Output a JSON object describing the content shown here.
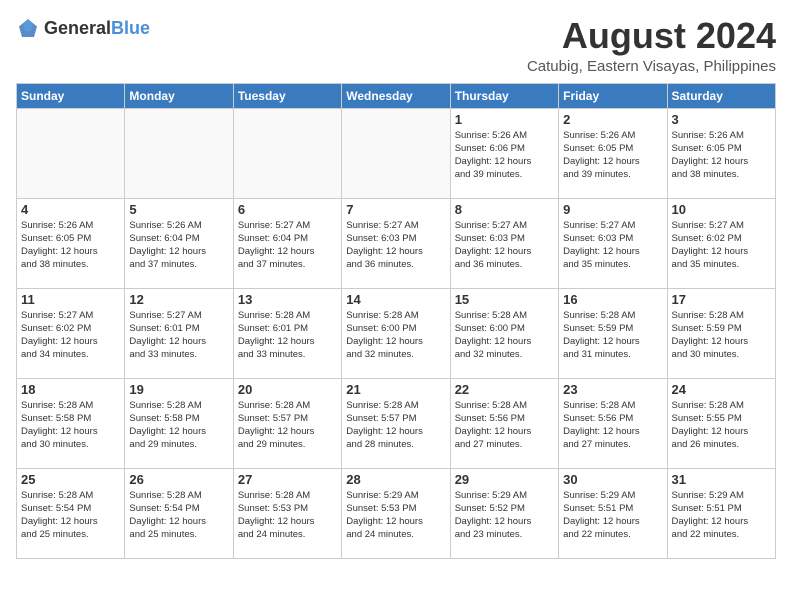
{
  "header": {
    "logo_general": "General",
    "logo_blue": "Blue",
    "month_year": "August 2024",
    "location": "Catubig, Eastern Visayas, Philippines"
  },
  "weekdays": [
    "Sunday",
    "Monday",
    "Tuesday",
    "Wednesday",
    "Thursday",
    "Friday",
    "Saturday"
  ],
  "weeks": [
    [
      {
        "day": "",
        "info": ""
      },
      {
        "day": "",
        "info": ""
      },
      {
        "day": "",
        "info": ""
      },
      {
        "day": "",
        "info": ""
      },
      {
        "day": "1",
        "info": "Sunrise: 5:26 AM\nSunset: 6:06 PM\nDaylight: 12 hours\nand 39 minutes."
      },
      {
        "day": "2",
        "info": "Sunrise: 5:26 AM\nSunset: 6:05 PM\nDaylight: 12 hours\nand 39 minutes."
      },
      {
        "day": "3",
        "info": "Sunrise: 5:26 AM\nSunset: 6:05 PM\nDaylight: 12 hours\nand 38 minutes."
      }
    ],
    [
      {
        "day": "4",
        "info": "Sunrise: 5:26 AM\nSunset: 6:05 PM\nDaylight: 12 hours\nand 38 minutes."
      },
      {
        "day": "5",
        "info": "Sunrise: 5:26 AM\nSunset: 6:04 PM\nDaylight: 12 hours\nand 37 minutes."
      },
      {
        "day": "6",
        "info": "Sunrise: 5:27 AM\nSunset: 6:04 PM\nDaylight: 12 hours\nand 37 minutes."
      },
      {
        "day": "7",
        "info": "Sunrise: 5:27 AM\nSunset: 6:03 PM\nDaylight: 12 hours\nand 36 minutes."
      },
      {
        "day": "8",
        "info": "Sunrise: 5:27 AM\nSunset: 6:03 PM\nDaylight: 12 hours\nand 36 minutes."
      },
      {
        "day": "9",
        "info": "Sunrise: 5:27 AM\nSunset: 6:03 PM\nDaylight: 12 hours\nand 35 minutes."
      },
      {
        "day": "10",
        "info": "Sunrise: 5:27 AM\nSunset: 6:02 PM\nDaylight: 12 hours\nand 35 minutes."
      }
    ],
    [
      {
        "day": "11",
        "info": "Sunrise: 5:27 AM\nSunset: 6:02 PM\nDaylight: 12 hours\nand 34 minutes."
      },
      {
        "day": "12",
        "info": "Sunrise: 5:27 AM\nSunset: 6:01 PM\nDaylight: 12 hours\nand 33 minutes."
      },
      {
        "day": "13",
        "info": "Sunrise: 5:28 AM\nSunset: 6:01 PM\nDaylight: 12 hours\nand 33 minutes."
      },
      {
        "day": "14",
        "info": "Sunrise: 5:28 AM\nSunset: 6:00 PM\nDaylight: 12 hours\nand 32 minutes."
      },
      {
        "day": "15",
        "info": "Sunrise: 5:28 AM\nSunset: 6:00 PM\nDaylight: 12 hours\nand 32 minutes."
      },
      {
        "day": "16",
        "info": "Sunrise: 5:28 AM\nSunset: 5:59 PM\nDaylight: 12 hours\nand 31 minutes."
      },
      {
        "day": "17",
        "info": "Sunrise: 5:28 AM\nSunset: 5:59 PM\nDaylight: 12 hours\nand 30 minutes."
      }
    ],
    [
      {
        "day": "18",
        "info": "Sunrise: 5:28 AM\nSunset: 5:58 PM\nDaylight: 12 hours\nand 30 minutes."
      },
      {
        "day": "19",
        "info": "Sunrise: 5:28 AM\nSunset: 5:58 PM\nDaylight: 12 hours\nand 29 minutes."
      },
      {
        "day": "20",
        "info": "Sunrise: 5:28 AM\nSunset: 5:57 PM\nDaylight: 12 hours\nand 29 minutes."
      },
      {
        "day": "21",
        "info": "Sunrise: 5:28 AM\nSunset: 5:57 PM\nDaylight: 12 hours\nand 28 minutes."
      },
      {
        "day": "22",
        "info": "Sunrise: 5:28 AM\nSunset: 5:56 PM\nDaylight: 12 hours\nand 27 minutes."
      },
      {
        "day": "23",
        "info": "Sunrise: 5:28 AM\nSunset: 5:56 PM\nDaylight: 12 hours\nand 27 minutes."
      },
      {
        "day": "24",
        "info": "Sunrise: 5:28 AM\nSunset: 5:55 PM\nDaylight: 12 hours\nand 26 minutes."
      }
    ],
    [
      {
        "day": "25",
        "info": "Sunrise: 5:28 AM\nSunset: 5:54 PM\nDaylight: 12 hours\nand 25 minutes."
      },
      {
        "day": "26",
        "info": "Sunrise: 5:28 AM\nSunset: 5:54 PM\nDaylight: 12 hours\nand 25 minutes."
      },
      {
        "day": "27",
        "info": "Sunrise: 5:28 AM\nSunset: 5:53 PM\nDaylight: 12 hours\nand 24 minutes."
      },
      {
        "day": "28",
        "info": "Sunrise: 5:29 AM\nSunset: 5:53 PM\nDaylight: 12 hours\nand 24 minutes."
      },
      {
        "day": "29",
        "info": "Sunrise: 5:29 AM\nSunset: 5:52 PM\nDaylight: 12 hours\nand 23 minutes."
      },
      {
        "day": "30",
        "info": "Sunrise: 5:29 AM\nSunset: 5:51 PM\nDaylight: 12 hours\nand 22 minutes."
      },
      {
        "day": "31",
        "info": "Sunrise: 5:29 AM\nSunset: 5:51 PM\nDaylight: 12 hours\nand 22 minutes."
      }
    ]
  ]
}
